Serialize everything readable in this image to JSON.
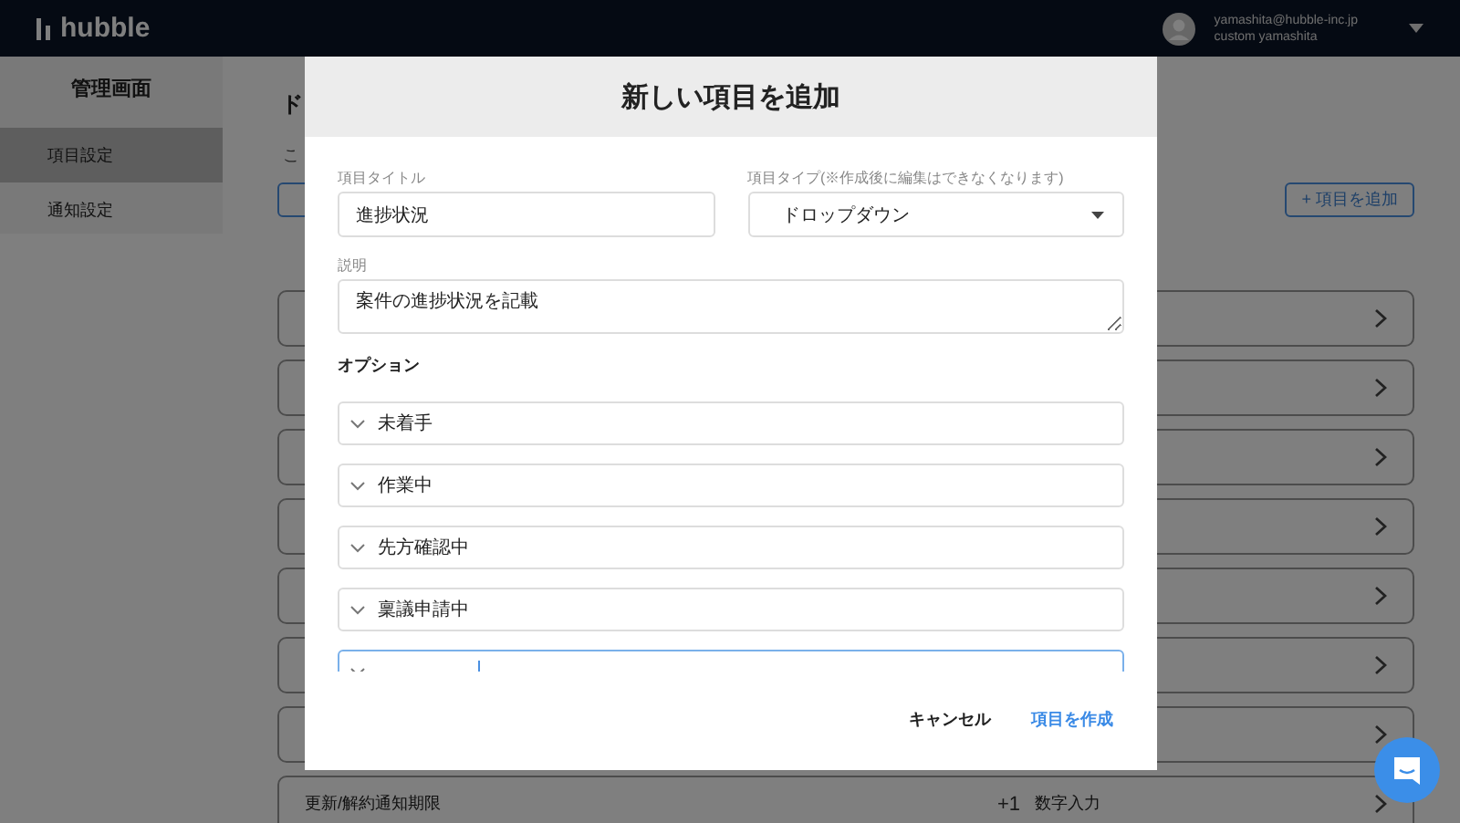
{
  "header": {
    "logo": "hubble",
    "user": {
      "email": "yamashita@hubble-inc.jp",
      "name": "custom yamashita"
    }
  },
  "sidebar": {
    "title": "管理画面",
    "items": [
      {
        "label": "項目設定",
        "selected": true
      },
      {
        "label": "通知設定",
        "selected": false
      }
    ]
  },
  "main": {
    "heading": "ド",
    "description": "こ",
    "add_button": "+ 項目を追加",
    "cards": [
      {
        "kind": "hidden"
      },
      {
        "kind": "hidden"
      },
      {
        "kind": "hidden"
      },
      {
        "kind": "hidden"
      },
      {
        "kind": "hidden"
      },
      {
        "kind": "hidden"
      },
      {
        "kind": "hidden"
      },
      {
        "kind": "item",
        "name": "更新/解約通知期限",
        "icon": "+1",
        "type": "数字入力"
      }
    ]
  },
  "dialog": {
    "title": "新しい項目を追加",
    "title_field": {
      "label": "項目タイトル",
      "value": "進捗状況"
    },
    "type_field": {
      "label": "項目タイプ(※作成後に編集はできなくなります)",
      "value": "ドロップダウン"
    },
    "description_field": {
      "label": "説明",
      "value": "案件の進捗状況を記載"
    },
    "options_label": "オプション",
    "options": [
      {
        "label": "未着手",
        "focused": false
      },
      {
        "label": "作業中",
        "focused": false
      },
      {
        "label": "先方確認中",
        "focused": false
      },
      {
        "label": "稟議申請中",
        "focused": false
      },
      {
        "focused": true
      }
    ],
    "buttons": [
      {
        "label": "キャンセル",
        "kind": "secondary"
      },
      {
        "label": "項目を作成",
        "kind": "primary"
      }
    ]
  }
}
